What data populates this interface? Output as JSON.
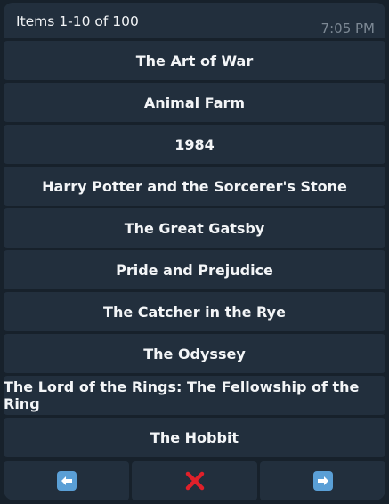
{
  "header": {
    "text": "Items 1-10 of 100",
    "time": "7:05 PM"
  },
  "items": [
    {
      "label": "The Art of War"
    },
    {
      "label": "Animal Farm"
    },
    {
      "label": "1984"
    },
    {
      "label": "Harry Potter and the Sorcerer's Stone"
    },
    {
      "label": "The Great Gatsby"
    },
    {
      "label": "Pride and Prejudice"
    },
    {
      "label": "The Catcher in the Rye"
    },
    {
      "label": "The Odyssey"
    },
    {
      "label": "The Lord of the Rings: The Fellowship of the Ring"
    },
    {
      "label": "The Hobbit"
    }
  ],
  "nav": {
    "prev_icon": "left-arrow-icon",
    "close_icon": "cross-mark-icon",
    "next_icon": "right-arrow-icon"
  },
  "colors": {
    "background": "#17212b",
    "button": "#222f3d",
    "arrow": "#5a9fd6",
    "close": "#e0202a"
  }
}
